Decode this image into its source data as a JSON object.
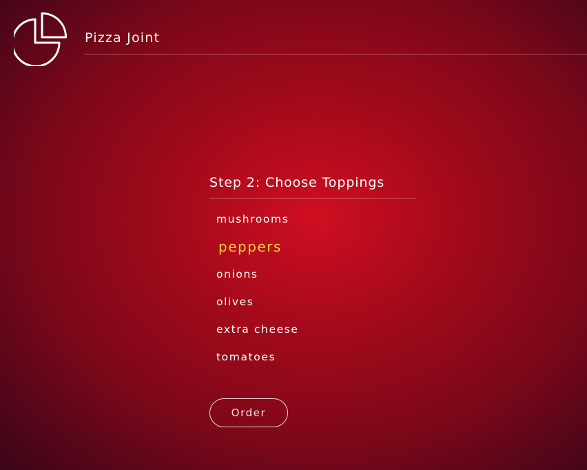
{
  "header": {
    "logo_icon": "pizza-slice-pie-icon",
    "site_title": "Pizza Joint"
  },
  "step": {
    "title": "Step 2: Choose Toppings"
  },
  "toppings": [
    {
      "label": "mushrooms",
      "selected": false
    },
    {
      "label": "peppers",
      "selected": true
    },
    {
      "label": "onions",
      "selected": false
    },
    {
      "label": "olives",
      "selected": false
    },
    {
      "label": "extra cheese",
      "selected": false
    },
    {
      "label": "tomatoes",
      "selected": false
    }
  ],
  "order_button": {
    "label": "Order"
  },
  "colors": {
    "background_center": "#cf0e21",
    "background_edge": "#3c0515",
    "text": "#ffffff",
    "selected_accent": "#f3d33a"
  }
}
